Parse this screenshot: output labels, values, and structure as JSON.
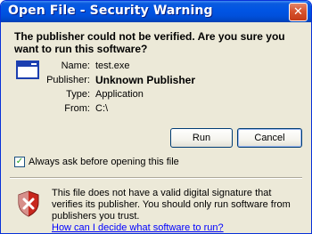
{
  "window": {
    "title": "Open File - Security Warning",
    "close_glyph": "✕"
  },
  "question": "The publisher could not be verified.  Are you sure you want to run this software?",
  "details": [
    {
      "label": "Name:",
      "value": "test.exe",
      "bold": false
    },
    {
      "label": "Publisher:",
      "value": "Unknown Publisher",
      "bold": true
    },
    {
      "label": "Type:",
      "value": "Application",
      "bold": false
    },
    {
      "label": "From:",
      "value": "C:\\",
      "bold": false
    }
  ],
  "buttons": {
    "run": "Run",
    "cancel": "Cancel"
  },
  "checkbox": {
    "label": "Always ask before opening this file",
    "checked": true,
    "check_glyph": "✓"
  },
  "warning": {
    "text": "This file does not have a valid digital signature that verifies its publisher.  You should only run software from publishers you trust.",
    "link": "How can I decide what software to run?"
  },
  "icons": {
    "app": "application-window-icon",
    "shield": "security-shield-warning-icon"
  },
  "colors": {
    "titlebar": "#0054e3",
    "dialog_bg": "#ece9d8",
    "link": "#0000ff",
    "shield_red": "#c8281e"
  }
}
